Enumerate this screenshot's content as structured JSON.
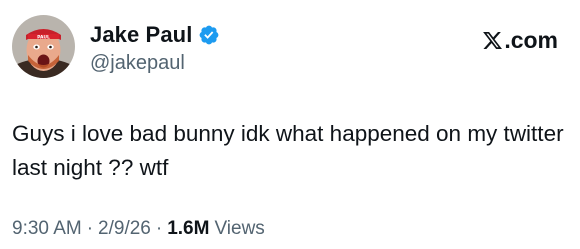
{
  "author": {
    "display_name": "Jake Paul",
    "handle": "@jakepaul",
    "verified": true,
    "verified_color": "#1d9bf0"
  },
  "brand": {
    "suffix": ".com",
    "icon": "x-logo-icon"
  },
  "tweet": {
    "text": "Guys i love bad bunny idk what happened on my twitter last night ?? wtf"
  },
  "meta": {
    "time": "9:30 AM",
    "date": "2/9/26",
    "separator": "·",
    "views_count": "1.6M",
    "views_label": "Views"
  },
  "colors": {
    "text_primary": "#0f1419",
    "text_secondary": "#536471",
    "accent": "#1d9bf0"
  }
}
